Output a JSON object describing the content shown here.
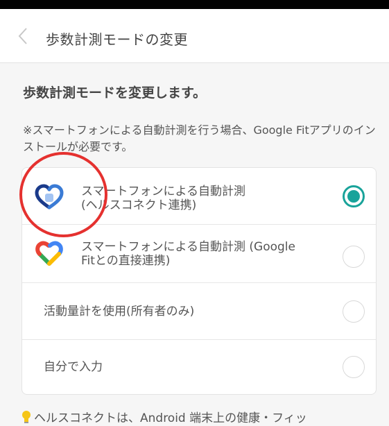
{
  "header": {
    "title": "歩数計測モードの変更"
  },
  "main": {
    "section_title": "歩数計測モードを変更します。",
    "note": "※スマートフォンによる自動計測を行う場合、Google Fitアプリのインストールが必要です。",
    "options": [
      {
        "line1": "スマートフォンによる自動計測",
        "line2": "(ヘルスコネクト連携)",
        "icon": "health-connect-icon",
        "selected": true
      },
      {
        "line1": "スマートフォンによる自動計測 (Google",
        "line2": "Fitとの直接連携)",
        "icon": "google-fit-icon",
        "selected": false
      },
      {
        "label": "活動量計を使用(所有者のみ)",
        "selected": false
      },
      {
        "label": "自分で入力",
        "selected": false
      }
    ],
    "footer_note": "ヘルスコネクトは、Android 端末上の健康・フィッ"
  },
  "colors": {
    "accent": "#19a39a",
    "annotation": "#e5312f",
    "background": "#f6f6f6"
  }
}
